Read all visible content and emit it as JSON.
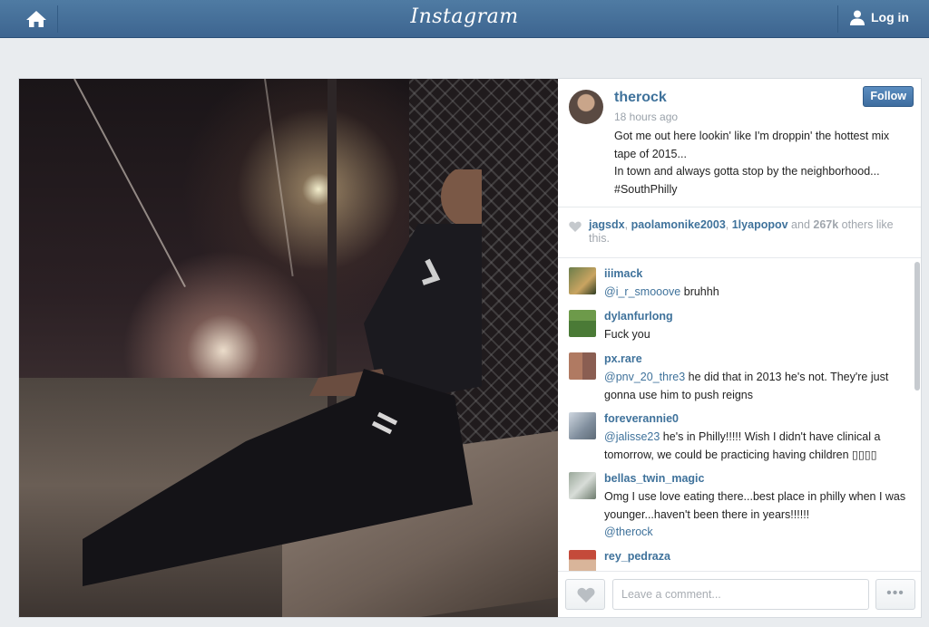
{
  "topbar": {
    "logo": "Instagram",
    "login_label": "Log in",
    "icons": {
      "home": "home-icon",
      "user": "user-icon"
    }
  },
  "post": {
    "photo_alt": "",
    "owner": {
      "username": "therock",
      "time": "18 hours ago",
      "caption_lines": [
        "Got me out here lookin' like I'm droppin' the hottest mix tape of 2015...",
        "In town and always gotta stop by the neighborhood...",
        "#SouthPhilly"
      ],
      "follow_label": "Follow"
    },
    "likes": {
      "users": [
        "jagsdx",
        "paolamonike2003",
        "1lyapopov"
      ],
      "sep1": ", ",
      "sep2": ", ",
      "and_text": " and ",
      "count": "267k",
      "suffix": " others like this."
    },
    "comments": [
      {
        "user": "iiimack",
        "mention": "@i_r_smooove",
        "text": " bruhhh"
      },
      {
        "user": "dylanfurlong",
        "mention": "",
        "text": "Fuck you"
      },
      {
        "user": "px.rare",
        "mention": "@pnv_20_thre3",
        "text": " he did that in 2013 he's not. They're just gonna use him to push reigns"
      },
      {
        "user": "foreverannie0",
        "mention": "@jalisse23",
        "text": " he's in Philly!!!!! Wish I didn't have clinical a tomorrow, we could be practicing having children ▯▯▯▯"
      },
      {
        "user": "bellas_twin_magic",
        "mention": "",
        "text": "Omg I use love eating there...best place in philly when I was younger...haven't been there in years!!!!!!",
        "mention_after": "@therock"
      },
      {
        "user": "rey_pedraza",
        "mention": "",
        "text": ""
      }
    ],
    "compose": {
      "placeholder": "Leave a comment...",
      "more_label": "•••"
    }
  },
  "colors": {
    "topbar": "#3d6590",
    "link": "#3f729b",
    "follow": "#3e6d9f",
    "background": "#e9ecef"
  }
}
